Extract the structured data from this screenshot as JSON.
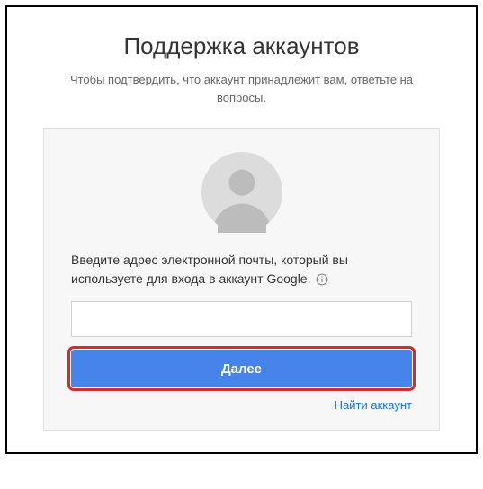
{
  "header": {
    "title": "Поддержка аккаунтов",
    "subtitle": "Чтобы подтвердить, что аккаунт принадлежит вам, ответьте на вопросы."
  },
  "card": {
    "instruction": "Введите адрес электронной почты, который вы используете для входа в аккаунт Google.",
    "email_value": "",
    "email_placeholder": "",
    "next_label": "Далее",
    "find_account_label": "Найти аккаунт"
  },
  "icons": {
    "avatar": "person-circle-icon",
    "info": "info-icon"
  },
  "colors": {
    "primary": "#4683ea",
    "highlight_outline": "#d22c2c",
    "link": "#1a73e8"
  }
}
